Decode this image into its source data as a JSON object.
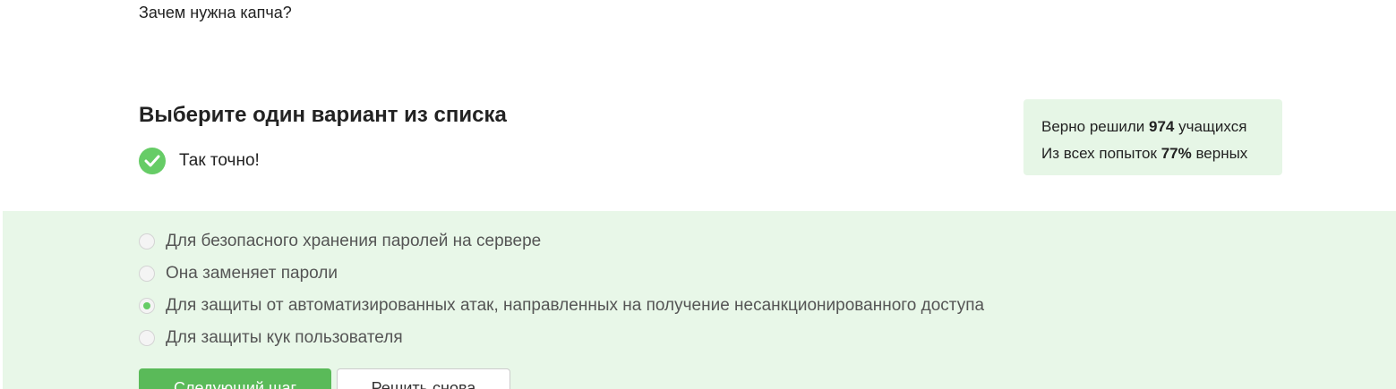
{
  "question": {
    "text": "Зачем нужна капча?"
  },
  "task": {
    "title": "Выберите один вариант из списка",
    "result_text": "Так точно!",
    "result_icon": "check-circle-icon"
  },
  "stats": {
    "line1_prefix": "Верно решили ",
    "line1_value": "974",
    "line1_suffix": " учащихся",
    "line2_prefix": "Из всех попыток ",
    "line2_value": "77%",
    "line2_suffix": " верных"
  },
  "options": [
    {
      "label": "Для безопасного хранения паролей на сервере",
      "selected": false
    },
    {
      "label": "Она заменяет пароли",
      "selected": false
    },
    {
      "label": "Для защиты от автоматизированных атак, направленных на получение несанкционированного доступа",
      "selected": true
    },
    {
      "label": "Для защиты кук пользователя",
      "selected": false
    }
  ],
  "buttons": {
    "next_label": "Следующий шаг",
    "retry_label": "Решить снова"
  },
  "colors": {
    "accent": "#66cc66",
    "options_background": "#e8f7e8",
    "stats_background": "#e6f6e6",
    "primary_button": "#5aba59"
  }
}
